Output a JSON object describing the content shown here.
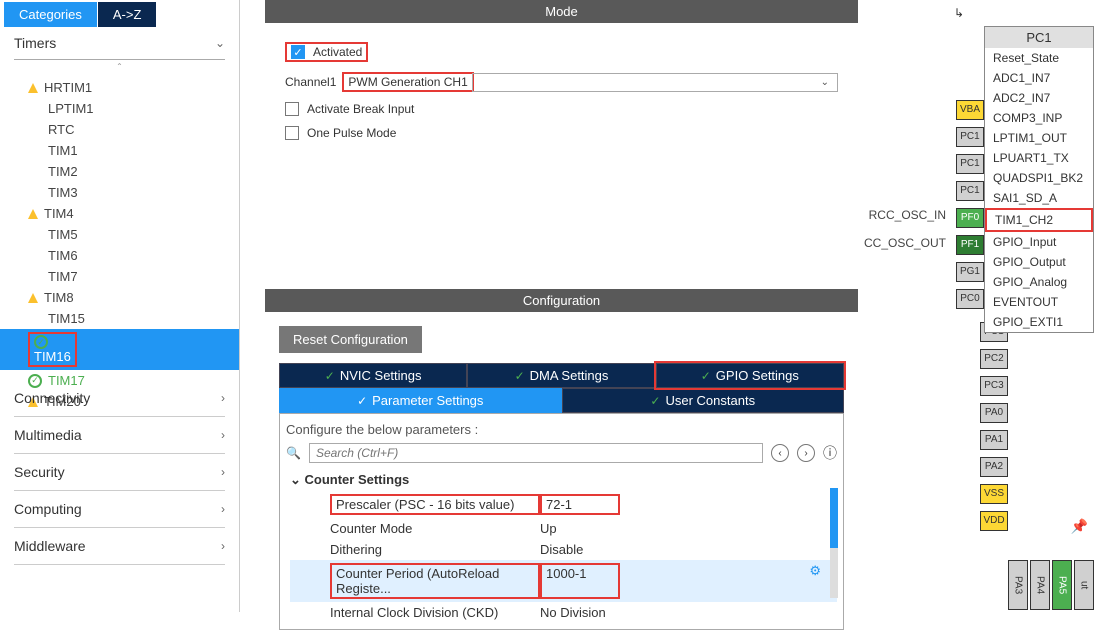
{
  "sidebar": {
    "tabs": {
      "categories": "Categories",
      "az": "A->Z"
    },
    "section_timers": "Timers",
    "timers": [
      {
        "label": "HRTIM1",
        "icon": "warn"
      },
      {
        "label": "LPTIM1",
        "icon": ""
      },
      {
        "label": "RTC",
        "icon": ""
      },
      {
        "label": "TIM1",
        "icon": ""
      },
      {
        "label": "TIM2",
        "icon": ""
      },
      {
        "label": "TIM3",
        "icon": ""
      },
      {
        "label": "TIM4",
        "icon": "warn"
      },
      {
        "label": "TIM5",
        "icon": ""
      },
      {
        "label": "TIM6",
        "icon": ""
      },
      {
        "label": "TIM7",
        "icon": ""
      },
      {
        "label": "TIM8",
        "icon": "warn"
      },
      {
        "label": "TIM15",
        "icon": ""
      },
      {
        "label": "TIM16",
        "icon": "ok",
        "selected": true,
        "highlight": true
      },
      {
        "label": "TIM17",
        "icon": "ok"
      },
      {
        "label": "TIM20",
        "icon": "warn"
      }
    ],
    "groups": {
      "connectivity": "Connectivity",
      "multimedia": "Multimedia",
      "security": "Security",
      "computing": "Computing",
      "middleware": "Middleware"
    }
  },
  "mode": {
    "title": "Mode",
    "activated": "Activated",
    "channel1_label": "Channel1",
    "channel1_value": "PWM Generation CH1",
    "activate_break": "Activate Break Input",
    "one_pulse": "One Pulse Mode"
  },
  "config": {
    "title": "Configuration",
    "reset": "Reset Configuration",
    "tabs": {
      "nvic": "NVIC Settings",
      "dma": "DMA Settings",
      "gpio": "GPIO Settings",
      "param": "Parameter Settings",
      "user": "User Constants"
    },
    "hint": "Configure the below parameters :",
    "search_placeholder": "Search (Ctrl+F)",
    "group_counter": "Counter Settings",
    "params": [
      {
        "name": "Prescaler (PSC - 16 bits value)",
        "value": "72-1",
        "highlight": true
      },
      {
        "name": "Counter Mode",
        "value": "Up"
      },
      {
        "name": "Dithering",
        "value": "Disable"
      },
      {
        "name": "Counter Period (AutoReload Registe...",
        "value": "1000-1",
        "highlight": true,
        "selected": true,
        "gear": true
      },
      {
        "name": "Internal Clock Division (CKD)",
        "value": "No Division"
      }
    ]
  },
  "pins": {
    "net1": "RCC_OSC_IN",
    "net2": "CC_OSC_OUT",
    "context_title": "PC1",
    "context_items": [
      "Reset_State",
      "ADC1_IN7",
      "ADC2_IN7",
      "COMP3_INP",
      "LPTIM1_OUT",
      "LPUART1_TX",
      "QUADSPI1_BK2",
      "SAI1_SD_A",
      "TIM1_CH2",
      "GPIO_Input",
      "GPIO_Output",
      "GPIO_Analog",
      "EVENTOUT",
      "GPIO_EXTI1"
    ],
    "left_col": [
      {
        "label": "VBA",
        "color": "yellow"
      },
      {
        "label": "PC1",
        "color": "grey"
      },
      {
        "label": "PC1",
        "color": "grey"
      },
      {
        "label": "PC1",
        "color": "grey"
      },
      {
        "label": "PF0",
        "color": "green"
      },
      {
        "label": "PF1",
        "color": "darkgreen"
      },
      {
        "label": "PG1",
        "color": "grey"
      },
      {
        "label": "PC0",
        "color": "grey"
      }
    ],
    "right_col": [
      {
        "label": "PC1",
        "color": "grey"
      },
      {
        "label": "PC2",
        "color": "grey"
      },
      {
        "label": "PC3",
        "color": "grey"
      },
      {
        "label": "PA0",
        "color": "grey"
      },
      {
        "label": "PA1",
        "color": "grey"
      },
      {
        "label": "PA2",
        "color": "grey"
      },
      {
        "label": "VSS",
        "color": "yellow"
      },
      {
        "label": "VDD",
        "color": "yellow"
      }
    ],
    "bottom": [
      {
        "label": "PA3",
        "color": "grey"
      },
      {
        "label": "PA4",
        "color": "grey"
      },
      {
        "label": "PA5",
        "color": "green"
      },
      {
        "label": "ut",
        "color": "grey"
      }
    ]
  }
}
